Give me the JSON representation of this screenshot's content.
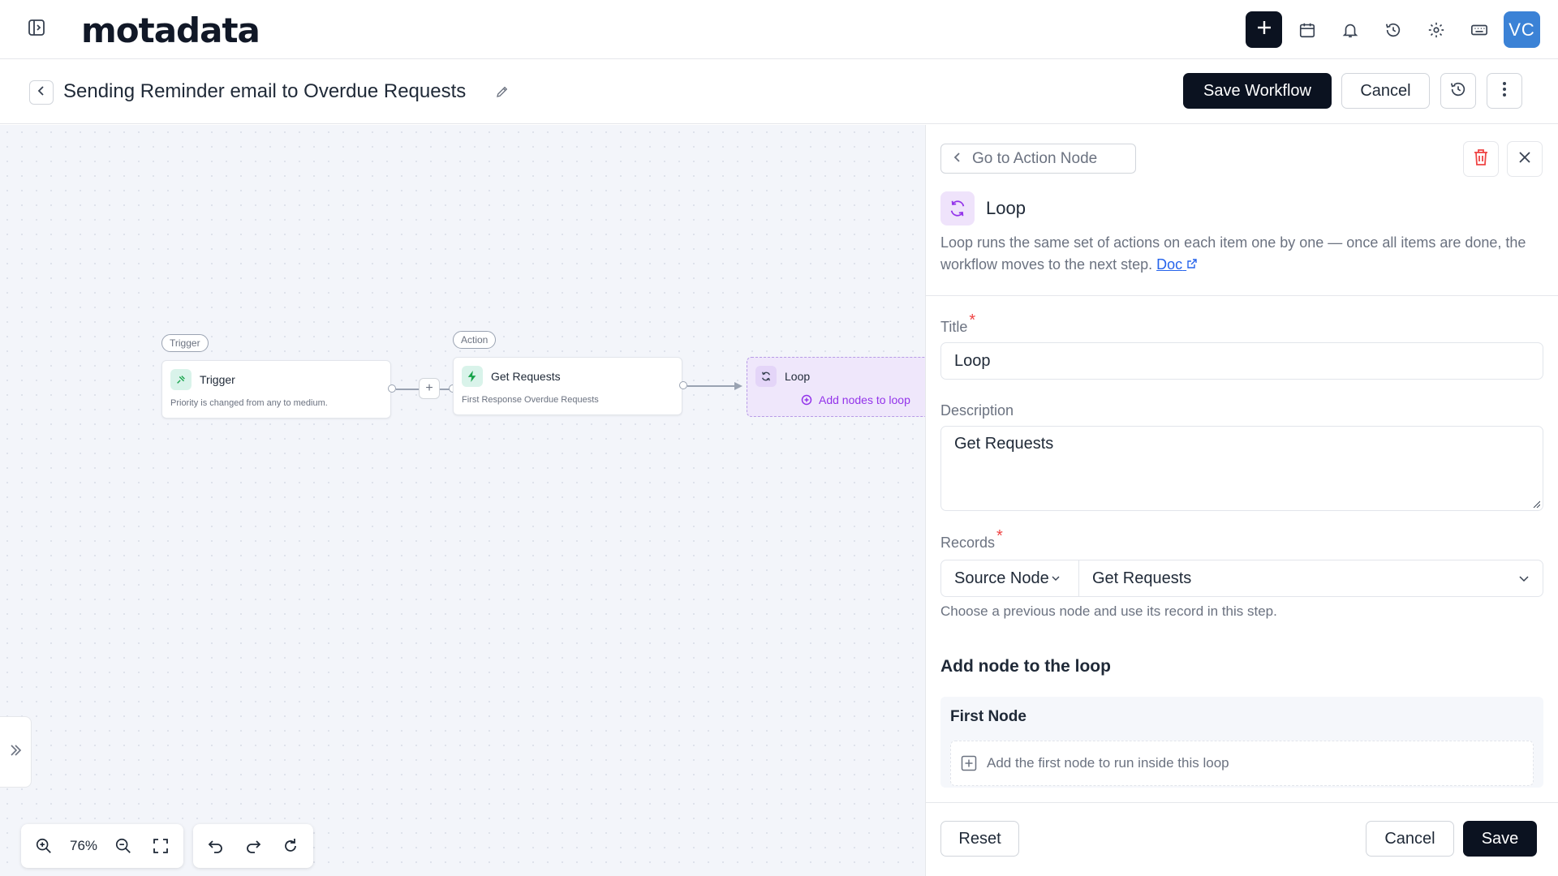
{
  "app": {
    "logo": "motadata",
    "avatar_initials": "VC"
  },
  "topbar": {
    "icons": [
      "sidebar-toggle-icon",
      "plus-icon",
      "calendar-icon",
      "bell-icon",
      "history-icon",
      "gear-icon",
      "keyboard-icon"
    ]
  },
  "header": {
    "title": "Sending Reminder email to Overdue Requests",
    "save_label": "Save Workflow",
    "cancel_label": "Cancel"
  },
  "canvas": {
    "nodes": {
      "trigger": {
        "tag": "Trigger",
        "title": "Trigger",
        "subtitle": "Priority is changed from any to medium."
      },
      "action": {
        "tag": "Action",
        "title": "Get Requests",
        "subtitle": "First Response Overdue Requests"
      },
      "loop": {
        "title": "Loop",
        "add_label": "Add nodes to loop"
      }
    },
    "zoom": "76%"
  },
  "panel": {
    "goto_label": "Go to Action Node",
    "node_title": "Loop",
    "description_text": "Loop runs the same set of actions on each item one by one — once all items are done, the workflow moves to the next step.",
    "doc_link": "Doc",
    "title_label": "Title",
    "title_value": "Loop",
    "description_label": "Description",
    "description_value": "Get Requests",
    "records_label": "Records",
    "source_select": "Source Node",
    "records_select": "Get Requests",
    "records_help": "Choose a previous node and use its record in this step.",
    "loop_section_title": "Add node to the loop",
    "first_node_title": "First Node",
    "first_node_add": "Add the first node to run inside this loop",
    "reset_label": "Reset",
    "cancel_label": "Cancel",
    "save_label": "Save"
  },
  "colors": {
    "primary_dark": "#0b1220",
    "accent_purple": "#9333ea",
    "link_blue": "#2563eb",
    "danger": "#ef4444",
    "avatar": "#3b82d6"
  }
}
